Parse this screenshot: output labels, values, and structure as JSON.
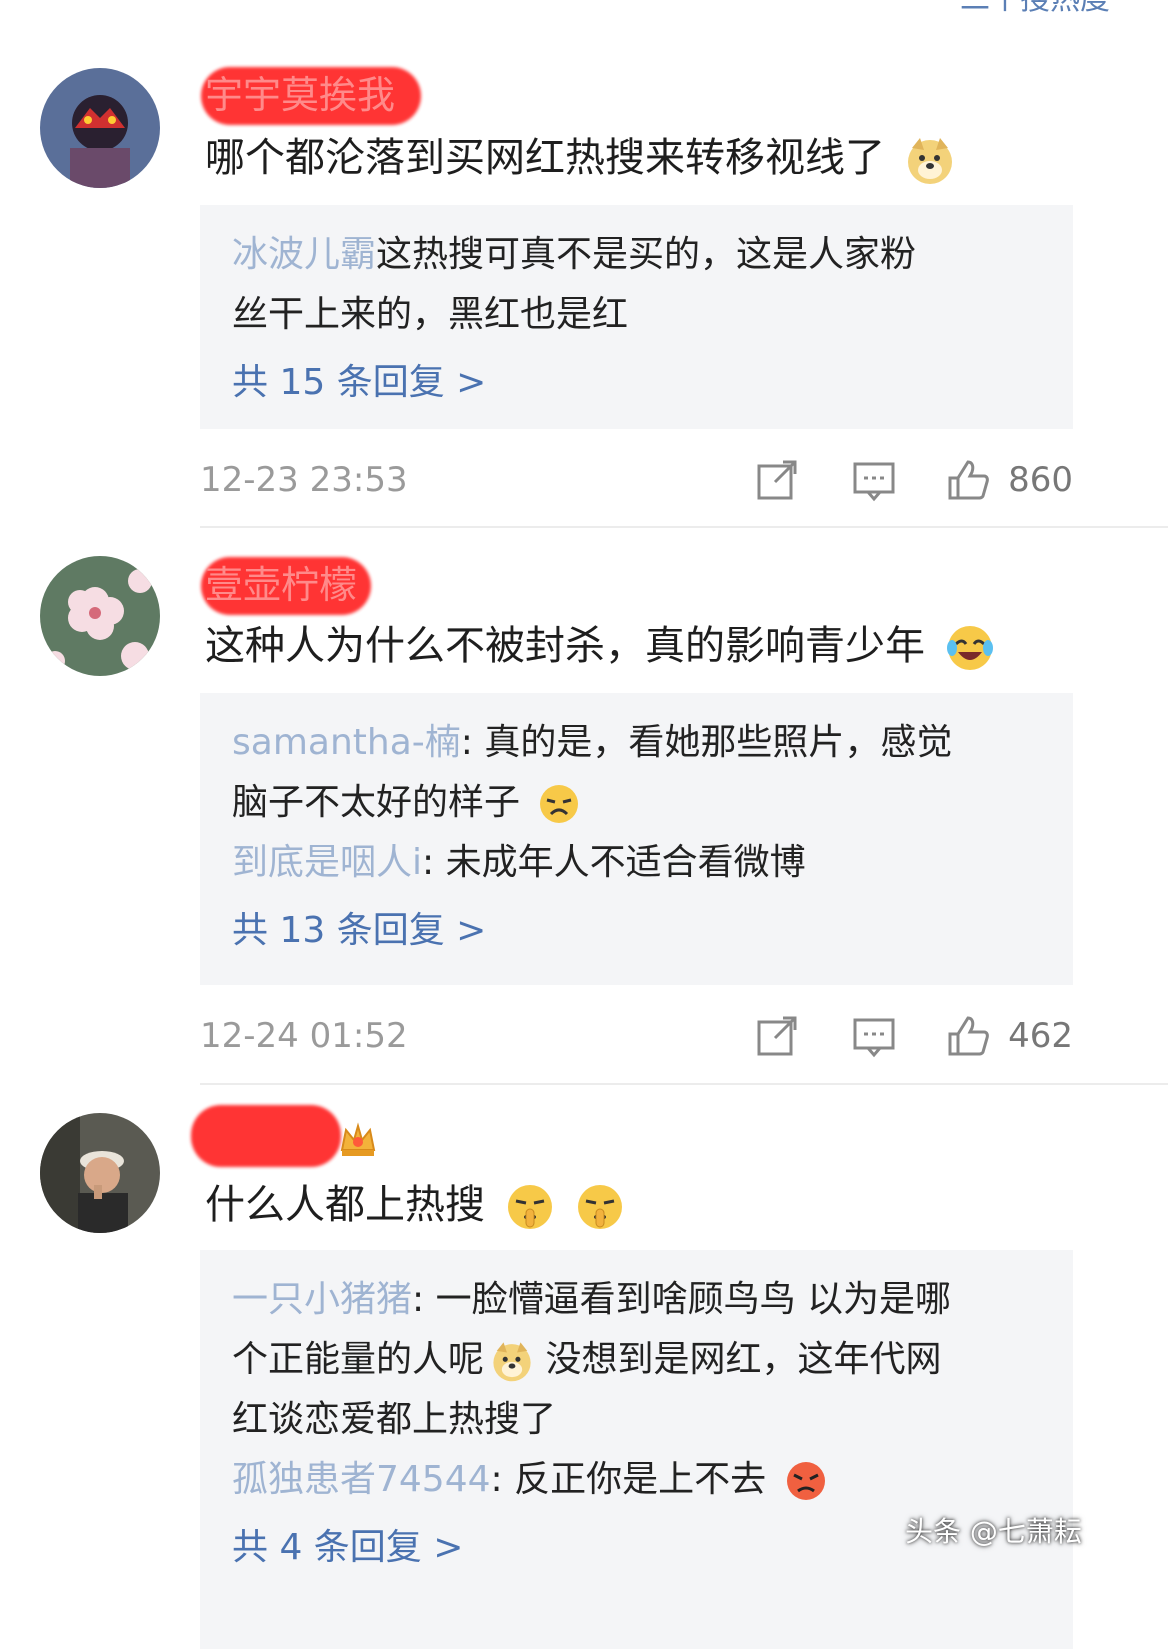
{
  "header_partial": "二个搜热度",
  "comments": [
    {
      "username": "宇宇莫挨我",
      "text": "哪个都沦落到买网红热搜来转移视线了",
      "emoji": "doge-emoji",
      "replies": [
        {
          "name": "冰波儿霸",
          "sep": "",
          "text": "这热搜可真不是买的，这是人家粉丝干上来的，黑红也是红",
          "text_line1": "这热搜可真不是买的，这是人家粉",
          "text_line2": "丝干上来的，黑红也是红"
        }
      ],
      "more": "共 15 条回复 >",
      "time": "12-23 23:53",
      "likes": "860"
    },
    {
      "username": "壹壶柠檬",
      "text": "这种人为什么不被封杀，真的影响青少年",
      "emoji": "laugh-cry-emoji",
      "replies": [
        {
          "name": "samantha-楠",
          "sep": ":",
          "text_line1": " 真的是，看她那些照片，感觉",
          "text_line2": "脑子不太好的样子"
        },
        {
          "name": "到底是咽人i",
          "sep": ":",
          "text_line1": " 未成年人不适合看微博"
        }
      ],
      "more": "共 13 条回复 >",
      "time": "12-24 01:52",
      "likes": "462"
    },
    {
      "username": "",
      "text": "什么人都上热搜",
      "emoji": "shush-emoji",
      "replies": [
        {
          "name": "一只小猪猪",
          "sep": ":",
          "text_line1": " 一脸懵逼看到啥顾鸟鸟 以为是哪",
          "text_line2": "个正能量的人呢",
          "text_line2b": " 没想到是网红，这年代网",
          "text_line3": "红谈恋爱都上热搜了"
        },
        {
          "name": "孤独患者74544",
          "sep": ":",
          "text_line1": " 反正你是上不去"
        }
      ],
      "more": "共 4 条回复 >"
    }
  ],
  "watermark": "头条 @七萧耘",
  "colors": {
    "link": "#5b7fb5",
    "reply_bg": "#f4f5f7",
    "redact": "#ff2a2a"
  }
}
